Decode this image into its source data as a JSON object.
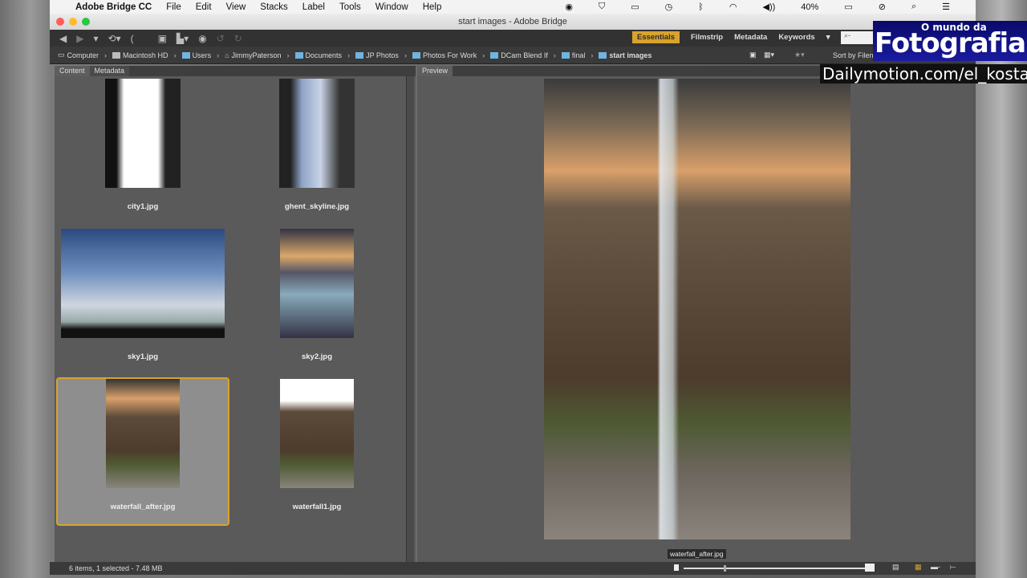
{
  "menubar": {
    "app": "Adobe Bridge CC",
    "items": [
      "File",
      "Edit",
      "View",
      "Stacks",
      "Label",
      "Tools",
      "Window",
      "Help"
    ],
    "battery": "40%"
  },
  "window": {
    "title": "start images - Adobe Bridge"
  },
  "workspaces": {
    "items": [
      "Essentials",
      "Filmstrip",
      "Metadata",
      "Keywords"
    ],
    "search_placeholder": "⌕-"
  },
  "path": [
    "Computer",
    "Macintosh HD",
    "Users",
    "JimmyPaterson",
    "Documents",
    "JP Photos",
    "Photos For Work",
    "DCam Blend If",
    "final",
    "start images"
  ],
  "sort_label": "Sort by Filename",
  "panels": {
    "content_tab": "Content",
    "metadata_tab": "Metadata",
    "preview_tab": "Preview"
  },
  "thumbnails": [
    {
      "name": "city1.jpg"
    },
    {
      "name": "ghent_skyline.jpg"
    },
    {
      "name": "sky1.jpg"
    },
    {
      "name": "sky2.jpg"
    },
    {
      "name": "waterfall_after.jpg",
      "selected": true
    },
    {
      "name": "waterfall1.jpg"
    }
  ],
  "preview": {
    "caption": "waterfall_after.jpg"
  },
  "status": {
    "text": "6 items, 1 selected - 7.48 MB",
    "thumb_size": 0.22
  },
  "watermark": {
    "small": "O mundo da",
    "big": "Fotografia",
    "url": "Dailymotion.com/el_kosta"
  }
}
